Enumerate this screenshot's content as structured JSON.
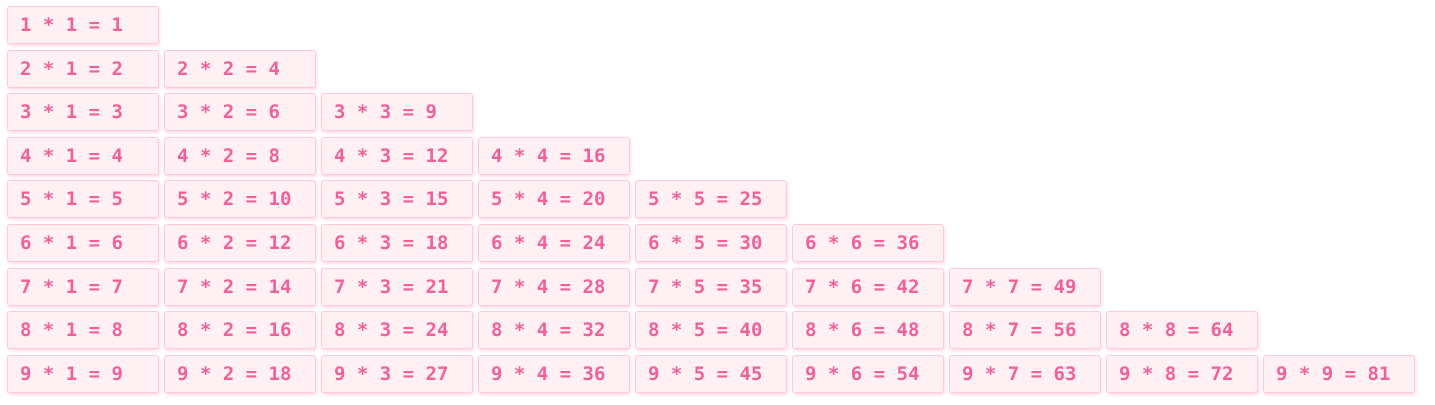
{
  "rows": [
    [
      "1 * 1 = 1"
    ],
    [
      "2 * 1 = 2",
      "2 * 2 = 4"
    ],
    [
      "3 * 1 = 3",
      "3 * 2 = 6",
      "3 * 3 = 9"
    ],
    [
      "4 * 1 = 4",
      "4 * 2 = 8",
      "4 * 3 = 12",
      "4 * 4 = 16"
    ],
    [
      "5 * 1 = 5",
      "5 * 2 = 10",
      "5 * 3 = 15",
      "5 * 4 = 20",
      "5 * 5 = 25"
    ],
    [
      "6 * 1 = 6",
      "6 * 2 = 12",
      "6 * 3 = 18",
      "6 * 4 = 24",
      "6 * 5 = 30",
      "6 * 6 = 36"
    ],
    [
      "7 * 1 = 7",
      "7 * 2 = 14",
      "7 * 3 = 21",
      "7 * 4 = 28",
      "7 * 5 = 35",
      "7 * 6 = 42",
      "7 * 7 = 49"
    ],
    [
      "8 * 1 = 8",
      "8 * 2 = 16",
      "8 * 3 = 24",
      "8 * 4 = 32",
      "8 * 5 = 40",
      "8 * 6 = 48",
      "8 * 7 = 56",
      "8 * 8 = 64"
    ],
    [
      "9 * 1 = 9",
      "9 * 2 = 18",
      "9 * 3 = 27",
      "9 * 4 = 36",
      "9 * 5 = 45",
      "9 * 6 = 54",
      "9 * 7 = 63",
      "9 * 8 = 72",
      "9 * 9 = 81"
    ]
  ],
  "colors": {
    "text": "#f0619a",
    "cell_background": "#fff0f4",
    "cell_border": "#ffc9d9"
  }
}
